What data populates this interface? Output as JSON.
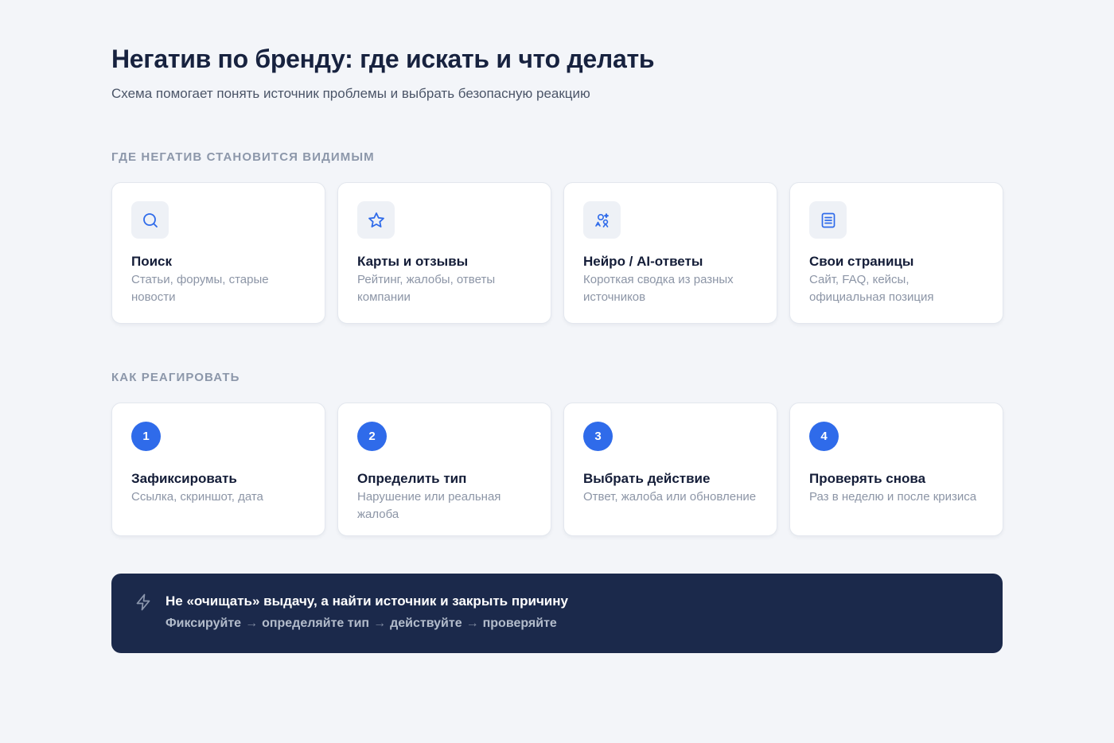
{
  "header": {
    "title": "Негатив по бренду: где искать и что делать",
    "subtitle": "Схема помогает понять источник проблемы и выбрать безопасную реакцию"
  },
  "sources_section": {
    "label": "ГДЕ НЕГАТИВ СТАНОВИТСЯ ВИДИМЫМ",
    "cards": [
      {
        "icon": "search-icon",
        "title": "Поиск",
        "desc": "Статьи, форумы, старые новости"
      },
      {
        "icon": "star-icon",
        "title": "Карты и отзывы",
        "desc": "Рейтинг, жалобы, ответы компании"
      },
      {
        "icon": "ai-sparkle-icon",
        "title": "Нейро / AI-ответы",
        "desc": "Короткая сводка из разных источников"
      },
      {
        "icon": "document-icon",
        "title": "Свои страницы",
        "desc": "Сайт, FAQ, кейсы, официальная позиция"
      }
    ]
  },
  "react_section": {
    "label": "КАК РЕАГИРОВАТЬ",
    "steps": [
      {
        "number": "1",
        "title": "Зафиксировать",
        "desc": "Ссылка, скриншот, дата"
      },
      {
        "number": "2",
        "title": "Определить тип",
        "desc": "Нарушение или реальная жалоба"
      },
      {
        "number": "3",
        "title": "Выбрать действие",
        "desc": "Ответ, жалоба или обновление"
      },
      {
        "number": "4",
        "title": "Проверять снова",
        "desc": "Раз в неделю и после кризиса"
      }
    ]
  },
  "banner": {
    "icon": "lightning-icon",
    "title": "Не «очищать» выдачу, а найти источник и закрыть причину",
    "steps": [
      "Фиксируйте",
      "определяйте тип",
      "действуйте",
      "проверяйте"
    ],
    "separator": "→"
  },
  "colors": {
    "background": "#f3f5f9",
    "accent": "#2f6bea",
    "banner": "#1b294b",
    "title": "#17223f",
    "muted": "#8c95a6"
  }
}
